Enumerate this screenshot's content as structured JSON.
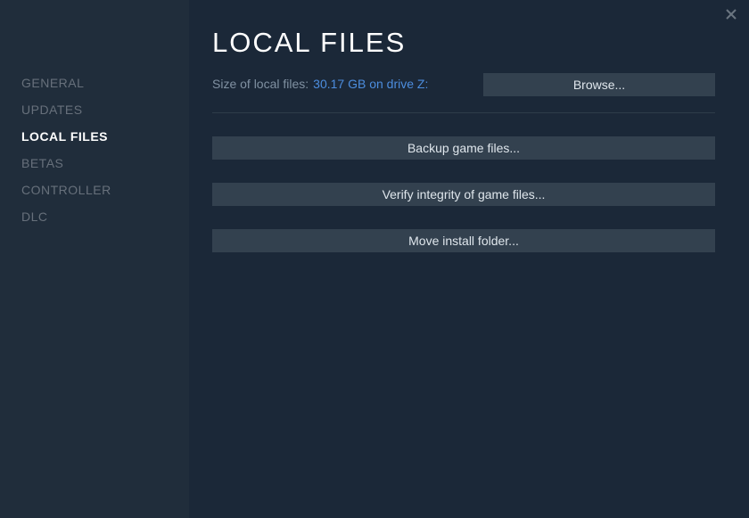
{
  "sidebar": {
    "items": [
      {
        "label": "GENERAL"
      },
      {
        "label": "UPDATES"
      },
      {
        "label": "LOCAL FILES"
      },
      {
        "label": "BETAS"
      },
      {
        "label": "CONTROLLER"
      },
      {
        "label": "DLC"
      }
    ]
  },
  "main": {
    "title": "LOCAL FILES",
    "size_label": "Size of local files:",
    "size_value": "30.17 GB on drive Z:",
    "browse_label": "Browse...",
    "actions": {
      "backup": "Backup game files...",
      "verify": "Verify integrity of game files...",
      "move": "Move install folder..."
    }
  }
}
